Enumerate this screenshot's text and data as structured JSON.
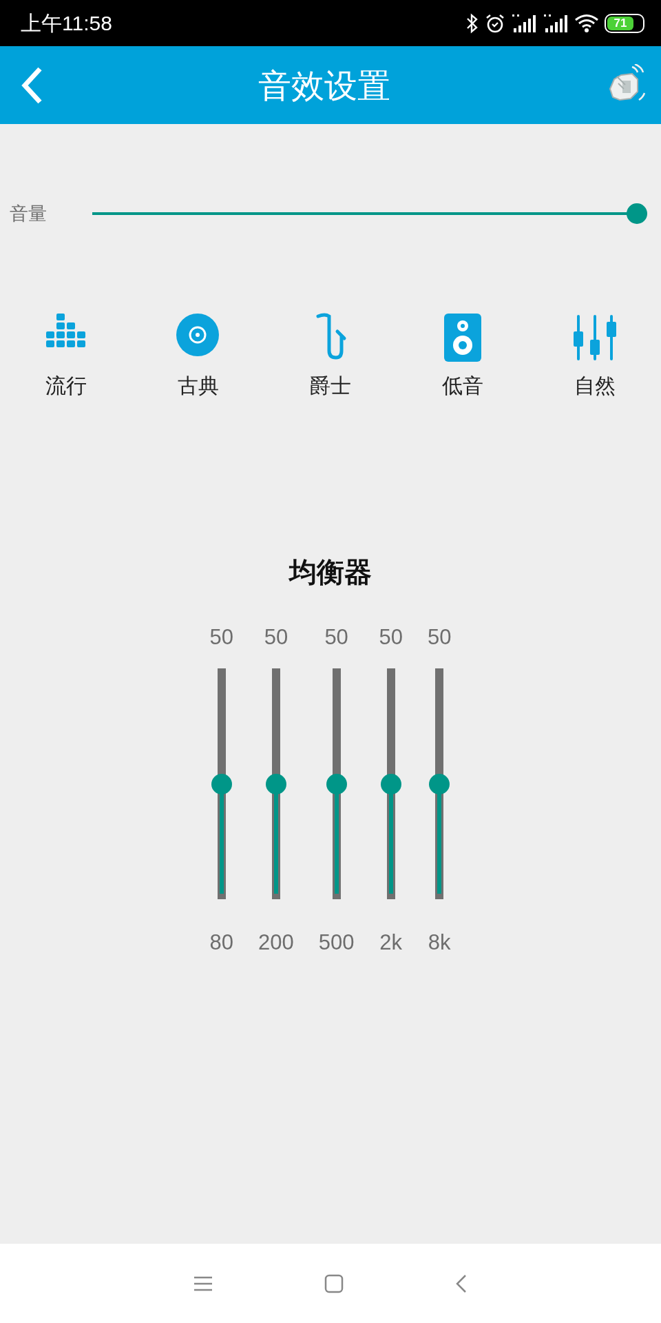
{
  "status_bar": {
    "time": "上午11:58",
    "battery": "71"
  },
  "header": {
    "title": "音效设置"
  },
  "volume": {
    "label": "音量",
    "level": 1.0
  },
  "presets": [
    {
      "kind": "pop",
      "label": "流行"
    },
    {
      "kind": "classical",
      "label": "古典"
    },
    {
      "kind": "jazz",
      "label": "爵士"
    },
    {
      "kind": "bass",
      "label": "低音"
    },
    {
      "kind": "natural",
      "label": "自然"
    }
  ],
  "equalizer": {
    "title": "均衡器",
    "bands": [
      {
        "value": "50",
        "frequency": "80",
        "level": 0.5
      },
      {
        "value": "50",
        "frequency": "200",
        "level": 0.5
      },
      {
        "value": "50",
        "frequency": "500",
        "level": 0.5
      },
      {
        "value": "50",
        "frequency": "2k",
        "level": 0.5
      },
      {
        "value": "50",
        "frequency": "8k",
        "level": 0.5
      }
    ]
  }
}
